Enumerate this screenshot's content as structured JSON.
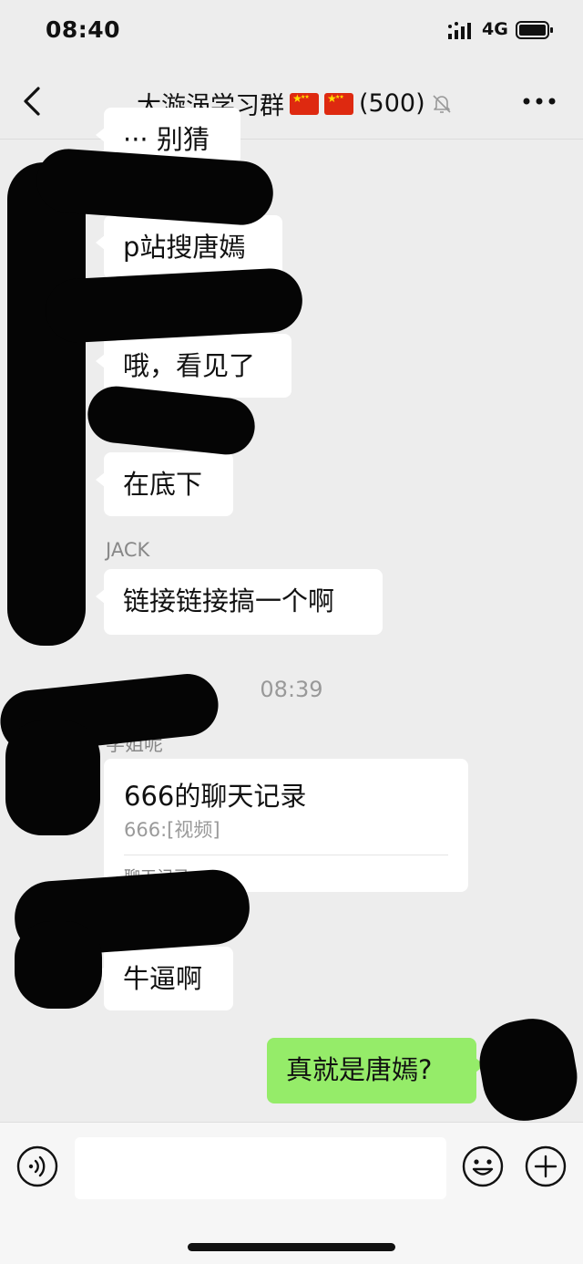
{
  "status_bar": {
    "time": "08:40",
    "network": "4G"
  },
  "nav": {
    "title": "大漩涡学习群",
    "member_count": "(500)"
  },
  "messages": [
    {
      "sender": "",
      "text": "··· 别猜"
    },
    {
      "sender": "",
      "text": "p站搜唐嫣"
    },
    {
      "sender": "",
      "text": "哦，看见了"
    },
    {
      "sender": "",
      "text": "在底下"
    },
    {
      "sender": "JACK",
      "text": "链接链接搞一个啊"
    },
    {
      "timestamp": "08:39"
    },
    {
      "sender": "学姐呢",
      "card": {
        "title": "666的聊天记录",
        "subtitle": "666:[视频]",
        "type": "聊天记录"
      }
    },
    {
      "sender": "",
      "text": "牛逼啊"
    },
    {
      "mine": true,
      "text": "真就是唐嫣?"
    }
  ],
  "input": {
    "placeholder": ""
  },
  "colors": {
    "background": "#ededed",
    "my_bubble": "#95ec69",
    "other_bubble": "#ffffff"
  }
}
